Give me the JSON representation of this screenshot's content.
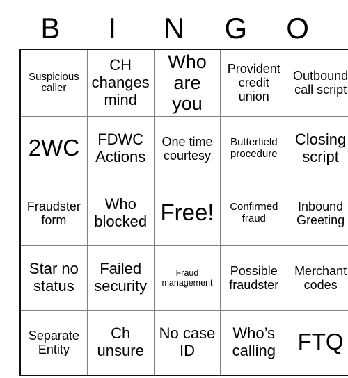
{
  "header": {
    "letters": [
      "B",
      "I",
      "N",
      "G",
      "O"
    ]
  },
  "grid": {
    "rows": [
      [
        {
          "text": "Suspicious caller",
          "size": "fs-sm"
        },
        {
          "text": "CH changes mind",
          "size": "fs-lg"
        },
        {
          "text": "Who are you",
          "size": "fs-xl"
        },
        {
          "text": "Provident credit union",
          "size": "fs-md"
        },
        {
          "text": "Outbound call script",
          "size": "fs-md"
        }
      ],
      [
        {
          "text": "2WC",
          "size": "fs-xxl"
        },
        {
          "text": "FDWC Actions",
          "size": "fs-lg"
        },
        {
          "text": "One time courtesy",
          "size": "fs-md"
        },
        {
          "text": "Butterfield procedure",
          "size": "fs-sm"
        },
        {
          "text": "Closing script",
          "size": "fs-lg"
        }
      ],
      [
        {
          "text": "Fraudster form",
          "size": "fs-md"
        },
        {
          "text": "Who blocked",
          "size": "fs-lg"
        },
        {
          "text": "Free!",
          "size": "fs-xxl"
        },
        {
          "text": "Confirmed fraud",
          "size": "fs-sm"
        },
        {
          "text": "Inbound Greeting",
          "size": "fs-md"
        }
      ],
      [
        {
          "text": "Star no status",
          "size": "fs-lg"
        },
        {
          "text": "Failed security",
          "size": "fs-lg"
        },
        {
          "text": "Fraud management",
          "size": "fs-xs"
        },
        {
          "text": "Possible fraudster",
          "size": "fs-md"
        },
        {
          "text": "Merchant codes",
          "size": "fs-md"
        }
      ],
      [
        {
          "text": "Separate Entity",
          "size": "fs-md"
        },
        {
          "text": "Ch unsure",
          "size": "fs-lg"
        },
        {
          "text": "No case ID",
          "size": "fs-lg"
        },
        {
          "text": "Who’s calling",
          "size": "fs-lg"
        },
        {
          "text": "FTQ",
          "size": "fs-xxl"
        }
      ]
    ]
  }
}
